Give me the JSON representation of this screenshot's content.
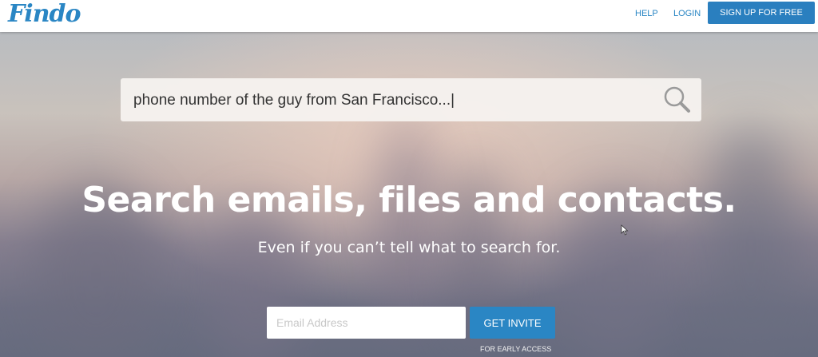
{
  "header": {
    "logo": "Findo",
    "nav": {
      "help": "HELP",
      "login": "LOGIN"
    },
    "signup_label": "SIGN UP FOR FREE"
  },
  "search": {
    "value": "phone number of the guy from San Francisco...|",
    "icon": "search-icon"
  },
  "hero": {
    "headline": "Search emails, files and contacts.",
    "subline": "Even if you can’t tell what to search for."
  },
  "invite": {
    "email_placeholder": "Email Address",
    "button_label": "GET INVITE",
    "note": "FOR EARLY ACCESS"
  },
  "colors": {
    "brand": "#2a86c4",
    "button": "#2a7fbf",
    "text_on_hero": "#ffffff"
  }
}
